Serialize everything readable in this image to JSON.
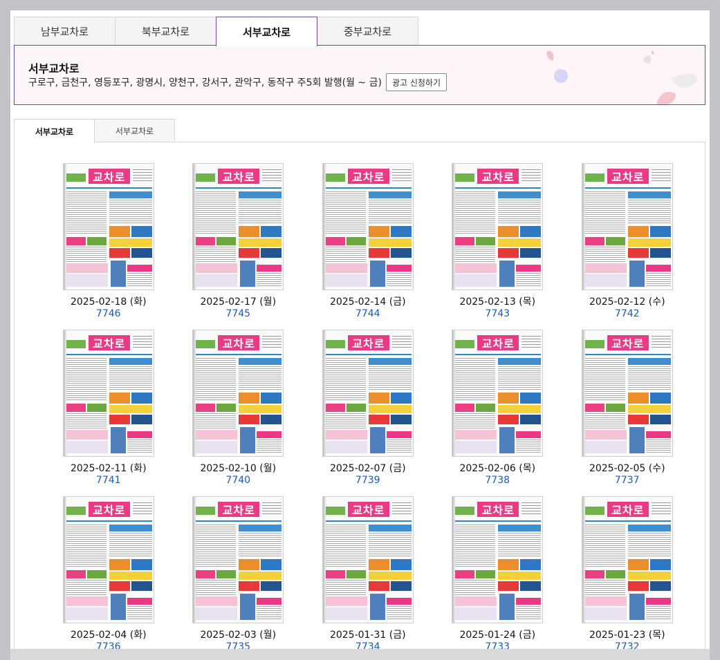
{
  "region_tabs": [
    {
      "label": "남부교차로",
      "active": false
    },
    {
      "label": "북부교차로",
      "active": false
    },
    {
      "label": "서부교차로",
      "active": true
    },
    {
      "label": "중부교차로",
      "active": false
    }
  ],
  "banner": {
    "title": "서부교차로",
    "description": "구로구, 금천구, 영등포구, 광명시, 양천구, 강서구, 관악구, 동작구 주5회 발행(월 ~ 금)",
    "apply_button": "광고 신청하기"
  },
  "sub_tabs": [
    {
      "label": "서부교차로",
      "active": true
    },
    {
      "label": "서부교차로",
      "active": false
    }
  ],
  "thumbnail": {
    "logo_text": "교차로"
  },
  "issues": [
    {
      "date": "2025-02-18 (화)",
      "number": "7746"
    },
    {
      "date": "2025-02-17 (월)",
      "number": "7745"
    },
    {
      "date": "2025-02-14 (금)",
      "number": "7744"
    },
    {
      "date": "2025-02-13 (목)",
      "number": "7743"
    },
    {
      "date": "2025-02-12 (수)",
      "number": "7742"
    },
    {
      "date": "2025-02-11 (화)",
      "number": "7741"
    },
    {
      "date": "2025-02-10 (월)",
      "number": "7740"
    },
    {
      "date": "2025-02-07 (금)",
      "number": "7739"
    },
    {
      "date": "2025-02-06 (목)",
      "number": "7738"
    },
    {
      "date": "2025-02-05 (수)",
      "number": "7737"
    },
    {
      "date": "2025-02-04 (화)",
      "number": "7736"
    },
    {
      "date": "2025-02-03 (월)",
      "number": "7735"
    },
    {
      "date": "2025-01-31 (금)",
      "number": "7734"
    },
    {
      "date": "2025-01-24 (금)",
      "number": "7733"
    },
    {
      "date": "2025-01-23 (목)",
      "number": "7732"
    }
  ],
  "colors": {
    "accent": "#6e4c9c",
    "link": "#1a59b5",
    "logo": "#ea3a84",
    "banner_bg": "#fdf5f7"
  }
}
